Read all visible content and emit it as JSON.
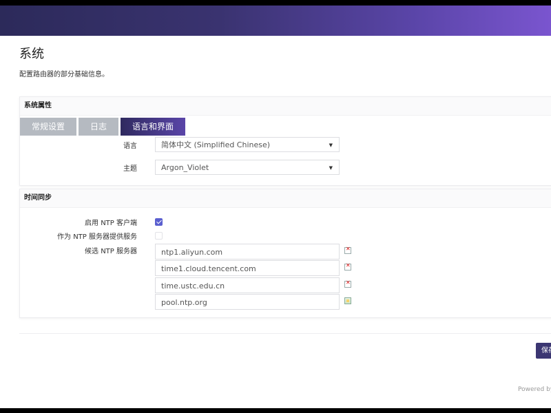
{
  "page": {
    "title": "系统",
    "description": "配置路由器的部分基础信息。"
  },
  "system_properties": {
    "header": "系统属性",
    "tabs": [
      {
        "label": "常规设置",
        "active": false
      },
      {
        "label": "日志",
        "active": false
      },
      {
        "label": "语言和界面",
        "active": true
      }
    ],
    "language": {
      "label": "语言",
      "value": "简体中文 (Simplified Chinese)"
    },
    "theme": {
      "label": "主题",
      "value": "Argon_Violet"
    }
  },
  "time_sync": {
    "header": "时间同步",
    "enable_ntp_client": {
      "label": "启用 NTP 客户端",
      "checked": true
    },
    "provide_ntp_server": {
      "label": "作为 NTP 服务器提供服务",
      "checked": false
    },
    "ntp_servers": {
      "label": "候选 NTP 服务器",
      "items": [
        {
          "value": "ntp1.aliyun.com",
          "icon": "remove-icon"
        },
        {
          "value": "time1.cloud.tencent.com",
          "icon": "remove-icon"
        },
        {
          "value": "time.ustc.edu.cn",
          "icon": "remove-icon"
        },
        {
          "value": "pool.ntp.org",
          "icon": "add-icon"
        }
      ]
    }
  },
  "actions": {
    "save_label": "保存"
  },
  "footer": {
    "text": "Powered by"
  },
  "colors": {
    "accent": "#5a45a8",
    "header_gradient_start": "#2c2a5a",
    "header_gradient_end": "#7a55cf",
    "checkbox": "#5a5fcf",
    "save_button": "#3b3672"
  }
}
